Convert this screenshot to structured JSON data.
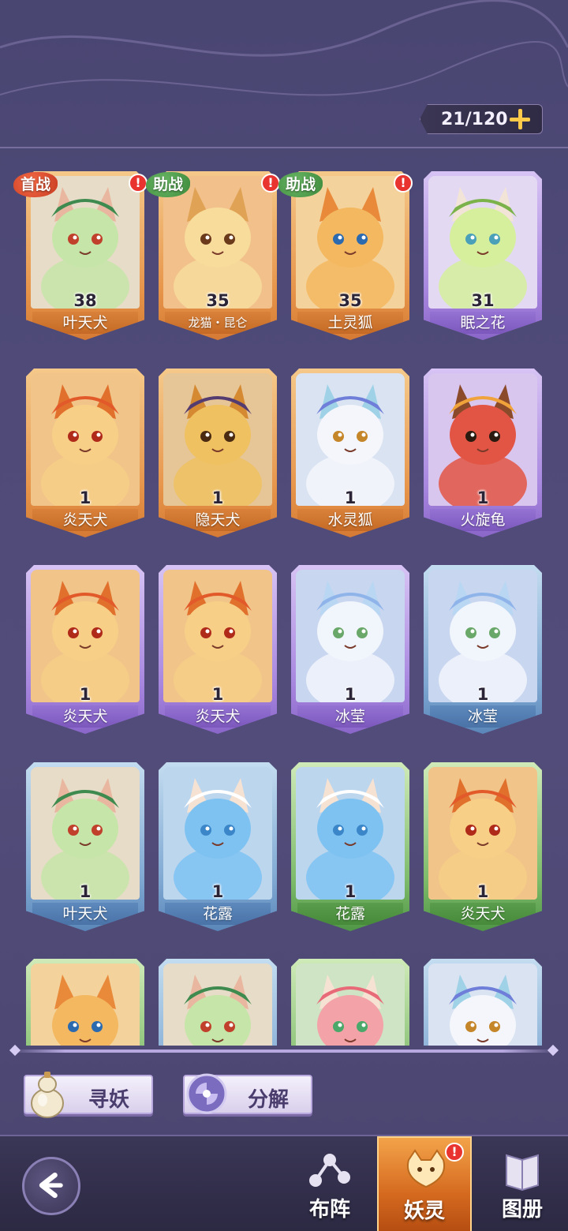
{
  "header": {
    "capacity": "21/120"
  },
  "cards": [
    {
      "level": "38",
      "name": "叶天犬",
      "frame": "orange",
      "badge": "首战",
      "badge_color": "red",
      "alert": true,
      "art": "green-fox"
    },
    {
      "level": "35",
      "name": "龙猫・昆仑",
      "frame": "orange",
      "badge": "助战",
      "badge_color": "grn",
      "alert": true,
      "art": "cream-cat",
      "small": true
    },
    {
      "level": "35",
      "name": "土灵狐",
      "frame": "orange",
      "badge": "助战",
      "badge_color": "grn",
      "alert": true,
      "art": "orange-fox"
    },
    {
      "level": "31",
      "name": "眠之花",
      "frame": "purple",
      "badge": "",
      "alert": false,
      "art": "flower-girl"
    },
    {
      "level": "1",
      "name": "炎天犬",
      "frame": "orange",
      "badge": "",
      "alert": false,
      "art": "fire-dog"
    },
    {
      "level": "1",
      "name": "隐天犬",
      "frame": "orange",
      "badge": "",
      "alert": false,
      "art": "ninja-dog"
    },
    {
      "level": "1",
      "name": "水灵狐",
      "frame": "orange",
      "badge": "",
      "alert": false,
      "art": "water-fox"
    },
    {
      "level": "1",
      "name": "火旋龟",
      "frame": "purple",
      "badge": "",
      "alert": false,
      "art": "fire-turtle"
    },
    {
      "level": "1",
      "name": "炎天犬",
      "frame": "purple",
      "badge": "",
      "alert": false,
      "art": "fire-dog"
    },
    {
      "level": "1",
      "name": "炎天犬",
      "frame": "purple",
      "badge": "",
      "alert": false,
      "art": "fire-dog"
    },
    {
      "level": "1",
      "name": "冰莹",
      "frame": "purple",
      "badge": "",
      "alert": false,
      "art": "ice-spirit"
    },
    {
      "level": "1",
      "name": "冰莹",
      "frame": "blue",
      "badge": "",
      "alert": false,
      "art": "ice-spirit"
    },
    {
      "level": "1",
      "name": "叶天犬",
      "frame": "blue",
      "badge": "",
      "alert": false,
      "art": "green-fox"
    },
    {
      "level": "1",
      "name": "花露",
      "frame": "blue",
      "badge": "",
      "alert": false,
      "art": "water-girl"
    },
    {
      "level": "1",
      "name": "花露",
      "frame": "green",
      "badge": "",
      "alert": false,
      "art": "water-girl"
    },
    {
      "level": "1",
      "name": "炎天犬",
      "frame": "green",
      "badge": "",
      "alert": false,
      "art": "fire-dog"
    },
    {
      "level": "",
      "name": "",
      "frame": "green",
      "badge": "",
      "alert": false,
      "art": "orange-fox"
    },
    {
      "level": "",
      "name": "",
      "frame": "blue",
      "badge": "",
      "alert": false,
      "art": "green-fox"
    },
    {
      "level": "",
      "name": "",
      "frame": "green",
      "badge": "",
      "alert": false,
      "art": "rose-girl"
    },
    {
      "level": "",
      "name": "",
      "frame": "blue",
      "badge": "",
      "alert": false,
      "art": "water-fox"
    }
  ],
  "actions": {
    "seek_label": "寻妖",
    "decompose_label": "分解"
  },
  "nav": {
    "formation_label": "布阵",
    "spirits_label": "妖灵",
    "atlas_label": "图册"
  },
  "colors": {
    "accent": "#ffc94a",
    "active_tab": "#e07a2a",
    "alert": "#e8332f"
  }
}
